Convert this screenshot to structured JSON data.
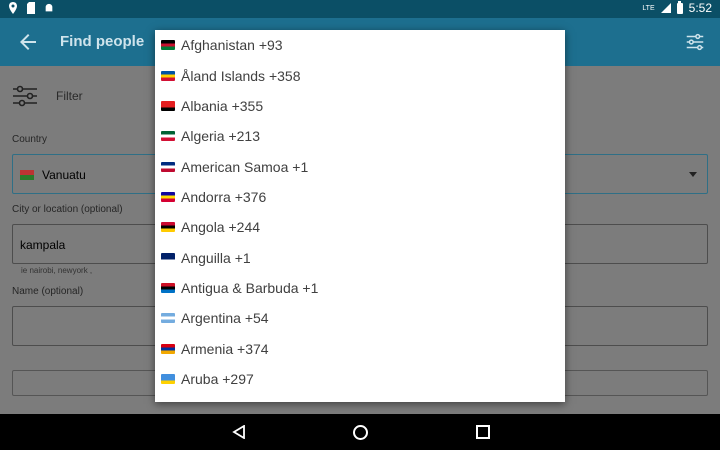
{
  "status_bar": {
    "time": "5:52",
    "network": "LTE"
  },
  "app_bar": {
    "title": "Find people"
  },
  "filter": {
    "label": "Filter"
  },
  "form": {
    "country_label": "Country",
    "country_value": "Vanuatu",
    "city_label": "City or location (optional)",
    "city_value": "kampala",
    "city_hint": "ie nairobi, newyork ,",
    "name_label": "Name (optional)"
  },
  "dropdown": {
    "items": [
      {
        "label": "Afghanistan +93",
        "flag": [
          "#000000",
          "#c8102e",
          "#007a36"
        ]
      },
      {
        "label": "Åland Islands +358",
        "flag": [
          "#0053a5",
          "#ffce00",
          "#d21034"
        ]
      },
      {
        "label": "Albania +355",
        "flag": [
          "#e41e20",
          "#e41e20",
          "#000000"
        ]
      },
      {
        "label": "Algeria +213",
        "flag": [
          "#006233",
          "#ffffff",
          "#d21034"
        ]
      },
      {
        "label": "American Samoa +1",
        "flag": [
          "#002b7f",
          "#ffffff",
          "#bf0a30"
        ]
      },
      {
        "label": "Andorra +376",
        "flag": [
          "#10069f",
          "#fedd00",
          "#d50032"
        ]
      },
      {
        "label": "Angola +244",
        "flag": [
          "#cc092f",
          "#000000",
          "#ffcb00"
        ]
      },
      {
        "label": "Anguilla +1",
        "flag": [
          "#012169",
          "#012169",
          "#ffffff"
        ]
      },
      {
        "label": "Antigua & Barbuda +1",
        "flag": [
          "#ce1126",
          "#000000",
          "#0072c6"
        ]
      },
      {
        "label": "Argentina +54",
        "flag": [
          "#74acdf",
          "#ffffff",
          "#74acdf"
        ]
      },
      {
        "label": "Armenia +374",
        "flag": [
          "#d90012",
          "#0033a0",
          "#f2a800"
        ]
      },
      {
        "label": "Aruba +297",
        "flag": [
          "#418fde",
          "#418fde",
          "#ffd100"
        ]
      }
    ]
  },
  "colors": {
    "appbar": "#1d6f8f",
    "statusbar": "#0b4f66",
    "scrim": "#7c7c7c"
  }
}
